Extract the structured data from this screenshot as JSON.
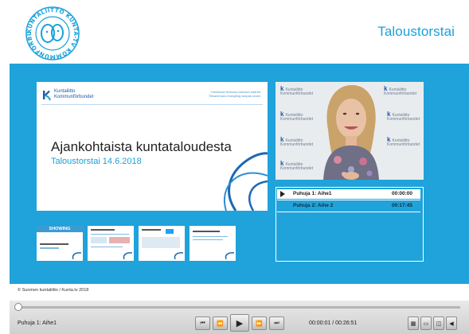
{
  "header": {
    "logo_ring_text": "KUNTALIITTO KUNTA-TV KOMMUNFÖRBUNDET",
    "title": "Taloustorstai"
  },
  "slide": {
    "org_name_fi": "Kuntaliitto",
    "org_name_sv": "Kommunförbundet",
    "tagline_line1": "Yhteisissä tiedossa tahtoset sääntä.",
    "tagline_line2": "Tillsammans framgång skapas snabt.",
    "title": "Ajankohtaista kuntataloudesta",
    "subtitle": "Taloustorstai 14.6.2018"
  },
  "thumbnails": {
    "showing_label": "SHOWING"
  },
  "video": {
    "bg_logo_fi": "Kuntaliitto",
    "bg_logo_sv": "Kommunförbundet"
  },
  "chapters": [
    {
      "label": "Puhuja 1: Aihe1",
      "time": "00:00:00",
      "active": true
    },
    {
      "label": "Puhuja 2: Aihe 2",
      "time": "00:17:45",
      "active": false
    }
  ],
  "footer": {
    "copyright": "© Suomen kuntaliitto / Kunta.tv 2018"
  },
  "player": {
    "now_playing": "Puhuja 1: Aihe1",
    "time_readout": "00:00:01 / 00:26:51",
    "progress": 0.001
  },
  "colors": {
    "brand_blue": "#1fa3da",
    "logo_blue": "#1aa1d9",
    "dark_blue": "#1a5aa8"
  }
}
